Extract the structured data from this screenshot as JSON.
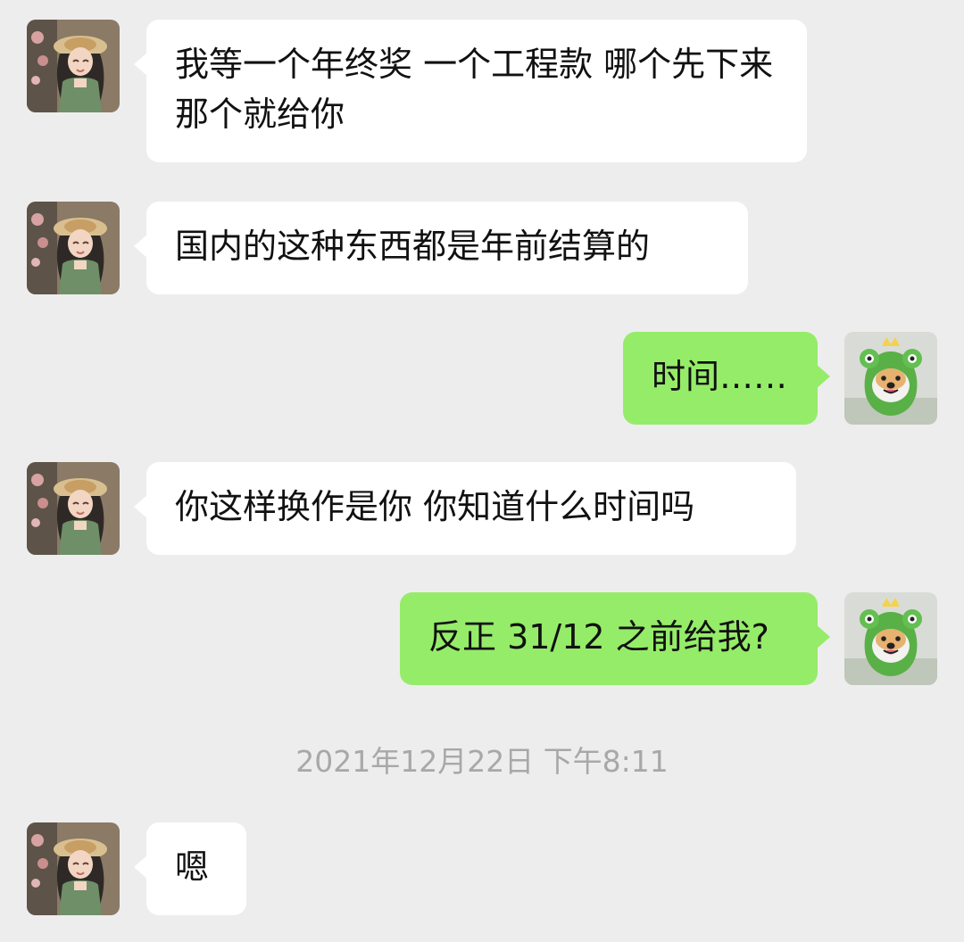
{
  "chat": {
    "messages": [
      {
        "side": "left",
        "text": "我等一个年终奖 一个工程款 哪个先下来 那个就给你"
      },
      {
        "side": "left",
        "text": "国内的这种东西都是年前结算的"
      },
      {
        "side": "right",
        "text": "时间……"
      },
      {
        "side": "left",
        "text": "你这样换作是你 你知道什么时间吗"
      },
      {
        "side": "right",
        "text": "反正 31/12 之前给我?"
      }
    ],
    "timestamp": "2021年12月22日 下午8:11",
    "last_message": {
      "side": "left",
      "text": "嗯"
    }
  },
  "colors": {
    "background": "#ededed",
    "incoming_bubble": "#ffffff",
    "outgoing_bubble": "#95ec69",
    "timestamp": "#a8a8a8"
  },
  "icons": {
    "incoming_avatar": "girl-avatar-icon",
    "outgoing_avatar": "frog-hat-dog-avatar-icon"
  }
}
